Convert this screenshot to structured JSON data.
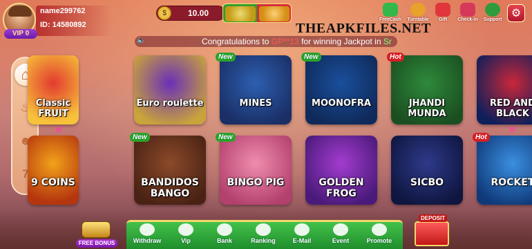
{
  "profile": {
    "username": "name299762",
    "id_text": "ID: 14580892",
    "vip_text": "VIP 0"
  },
  "wallet": {
    "coin_symbol": "$",
    "balance": "10.00"
  },
  "top_icons": [
    {
      "label": "FreeCash",
      "color": "#34b84a"
    },
    {
      "label": "Turntable",
      "color": "#e8a12a"
    },
    {
      "label": "Gift",
      "color": "#e0363b"
    },
    {
      "label": "Check-in",
      "color": "#d6385a"
    },
    {
      "label": "Support",
      "color": "#2e9c3a"
    }
  ],
  "settings_icon": "gear-icon",
  "marquee": {
    "prefix": "Congratulations to ",
    "user": "GP**13",
    "middle": " for winning Jackpot in ",
    "game": "Sr"
  },
  "watermark": "THEAPKFILES.NET",
  "sidebar": [
    {
      "icon": "home-icon",
      "glyph": "⌂",
      "active": true
    },
    {
      "icon": "fire-icon",
      "glyph": "🔥",
      "active": false
    },
    {
      "icon": "users-icon",
      "glyph": "👥",
      "active": false
    },
    {
      "icon": "slot-777-icon",
      "glyph": "7",
      "active": false
    }
  ],
  "games_row1": [
    {
      "title": "Classic FRUIT",
      "badge": "",
      "colors": [
        "#e23b2f",
        "#f7c23a"
      ]
    },
    {
      "title": "Euro roulette",
      "badge": "",
      "colors": [
        "#6a2fb8",
        "#c9a33b"
      ]
    },
    {
      "title": "MINES",
      "badge": "New",
      "colors": [
        "#2d5fb0",
        "#1a2f66"
      ]
    },
    {
      "title": "MOONOFRA",
      "badge": "New",
      "colors": [
        "#1a4f9c",
        "#0f2a5a"
      ]
    },
    {
      "title": "JHANDI MUNDA",
      "badge": "Hot",
      "colors": [
        "#2e8a3a",
        "#1b4f22"
      ]
    },
    {
      "title": "RED AND BLACK",
      "badge": "",
      "colors": [
        "#c9273a",
        "#0e1f5a"
      ]
    }
  ],
  "games_row2": [
    {
      "title": "9 COINS",
      "badge": "",
      "colors": [
        "#f2a21a",
        "#b5360e"
      ]
    },
    {
      "title": "BANDIDOS BANGO",
      "badge": "New",
      "colors": [
        "#8b4a2a",
        "#4a2214"
      ]
    },
    {
      "title": "BINGO PIG",
      "badge": "New",
      "colors": [
        "#f08dae",
        "#b3406e"
      ]
    },
    {
      "title": "GOLDEN FROG",
      "badge": "",
      "colors": [
        "#a33ccf",
        "#4a1a7a"
      ]
    },
    {
      "title": "SICBO",
      "badge": "",
      "colors": [
        "#2e3a8a",
        "#0f163f"
      ]
    },
    {
      "title": "ROCKET",
      "badge": "Hot",
      "colors": [
        "#3b8fe0",
        "#0f3a7a"
      ]
    }
  ],
  "arrows": {
    "left": "«",
    "right": "»"
  },
  "free_bonus": "FREE BONUS",
  "deposit": "DEPOSIT",
  "bottom_nav": [
    {
      "label": "Withdraw",
      "icon": "withdraw-icon"
    },
    {
      "label": "Vip",
      "icon": "vip-icon"
    },
    {
      "label": "Bank",
      "icon": "bank-icon"
    },
    {
      "label": "Ranking",
      "icon": "ranking-icon"
    },
    {
      "label": "E-Mail",
      "icon": "email-icon"
    },
    {
      "label": "Event",
      "icon": "event-icon"
    },
    {
      "label": "Promote",
      "icon": "promote-icon"
    }
  ]
}
